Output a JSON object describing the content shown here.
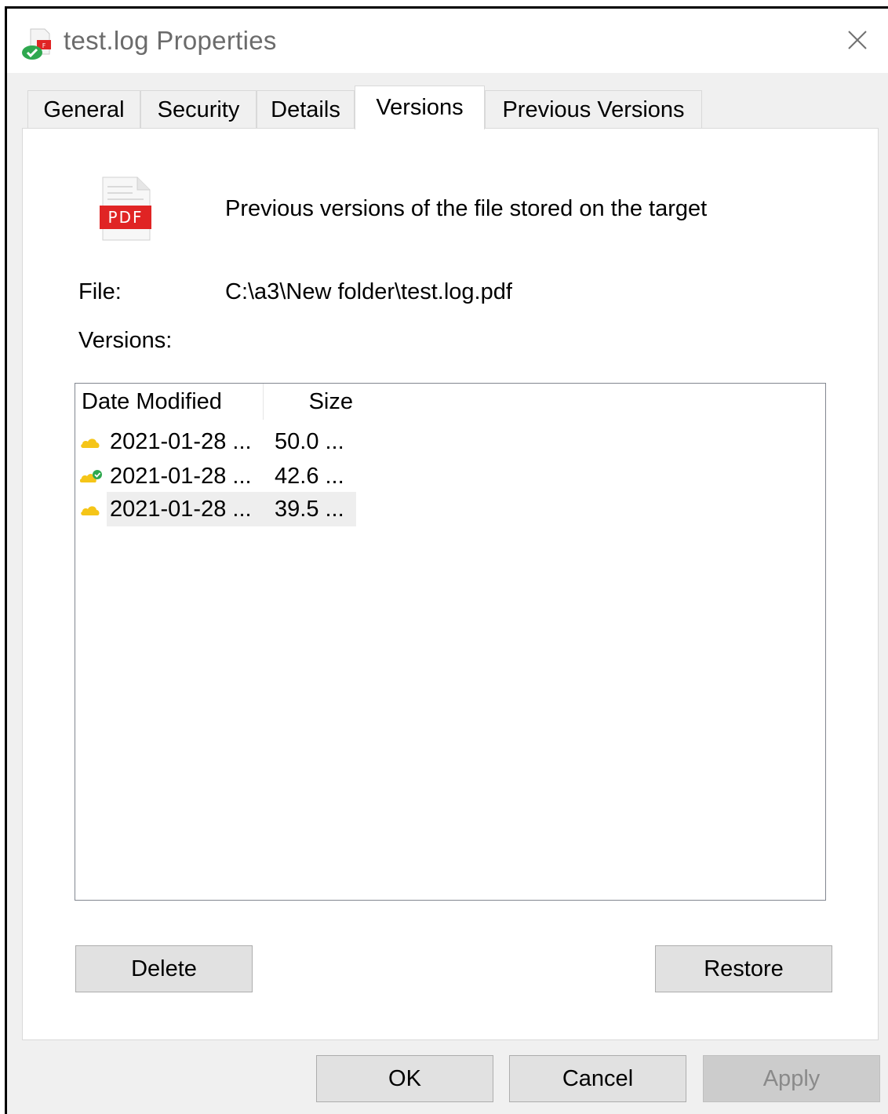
{
  "window": {
    "title": "test.log Properties",
    "close_icon": "close-icon",
    "app_icon": "pdf-file-with-sync-status-icon"
  },
  "tabs": [
    {
      "label": "General",
      "active": false
    },
    {
      "label": "Security",
      "active": false
    },
    {
      "label": "Details",
      "active": false
    },
    {
      "label": "Versions",
      "active": true
    },
    {
      "label": "Previous Versions",
      "active": false
    }
  ],
  "versions_tab": {
    "file_icon": "pdf-icon",
    "file_icon_text": "PDF",
    "description": "Previous versions of the file stored on the target",
    "file_label": "File:",
    "file_path": "C:\\a3\\New folder\\test.log.pdf",
    "versions_label": "Versions:",
    "columns": {
      "date": "Date Modified",
      "size": "Size"
    },
    "rows": [
      {
        "icon": "cloud-icon",
        "date": "2021-01-28 ...",
        "size": "50.0 ...",
        "selected": false
      },
      {
        "icon": "cloud-check-icon",
        "date": "2021-01-28 ...",
        "size": "42.6 ...",
        "selected": false
      },
      {
        "icon": "cloud-icon",
        "date": "2021-01-28 ...",
        "size": "39.5 ...",
        "selected": true
      }
    ],
    "delete_label": "Delete",
    "restore_label": "Restore"
  },
  "footer": {
    "ok_label": "OK",
    "cancel_label": "Cancel",
    "apply_label": "Apply",
    "apply_enabled": false
  },
  "colors": {
    "cloud": "#f5c518",
    "check": "#2fa84f",
    "pdf_red": "#e02424",
    "selection": "#eeeeee"
  }
}
